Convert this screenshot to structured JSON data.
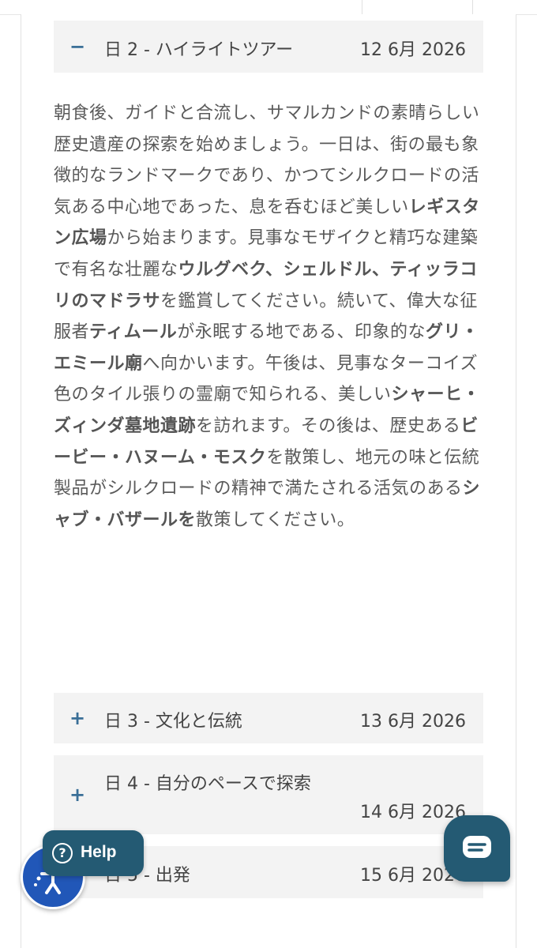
{
  "itinerary": {
    "day2": {
      "sign": "−",
      "title": "日 2 - ハイライトツアー",
      "date": "12 6月 2026",
      "description": [
        {
          "t": "朝食後、ガイドと合流し、サマルカンドの素晴らしい歴史遺産の探索を始めましょう。一日は、街の最も象徴的なランドマークであり、かつてシルクロードの活気ある中心地であった、息を呑むほど美しい",
          "b": false
        },
        {
          "t": "レギスタン広場",
          "b": true
        },
        {
          "t": "から始まります。見事なモザイクと精巧な建築で有名な壮麗な",
          "b": false
        },
        {
          "t": "ウルグベク、シェルドル、ティッラコリのマドラサ",
          "b": true
        },
        {
          "t": "を鑑賞してください。続いて、偉大な征服者",
          "b": false
        },
        {
          "t": "ティムール",
          "b": true
        },
        {
          "t": "が永眠する地である、印象的な",
          "b": false
        },
        {
          "t": "グリ・エミール廟",
          "b": true
        },
        {
          "t": "へ向かいます。午後は、見事なターコイズ色のタイル張りの霊廟で知られる、美しい",
          "b": false
        },
        {
          "t": "シャーヒ・ズィンダ墓地遺跡",
          "b": true
        },
        {
          "t": "を訪れます。その後は、歴史ある",
          "b": false
        },
        {
          "t": "ビービー・ハヌーム・モスク",
          "b": true
        },
        {
          "t": "を散策し、地元の味と伝統製品がシルクロードの精神で満たされる活気のある",
          "b": false
        },
        {
          "t": "シャブ・バザールを",
          "b": true
        },
        {
          "t": "散策してください。",
          "b": false
        }
      ]
    },
    "day3": {
      "sign": "+",
      "title": "日 3 - 文化と伝統",
      "date": "13 6月 2026"
    },
    "day4": {
      "sign": "+",
      "title": "日 4 - 自分のペースで探索",
      "date": "14 6月 2026"
    },
    "day5": {
      "sign": "+",
      "title": "日 5 - 出発",
      "date": "15 6月 2026"
    }
  },
  "widgets": {
    "help_label": "Help",
    "help_icon": "question-circle-icon",
    "accessibility_icon": "accessibility-icon",
    "chat_icon": "chat-bubble-icon"
  },
  "colors": {
    "accent": "#3a6f97",
    "help_bg": "#245a73",
    "accessibility_bg": "#2157b8",
    "accordion_bg": "#f3f3f3"
  }
}
